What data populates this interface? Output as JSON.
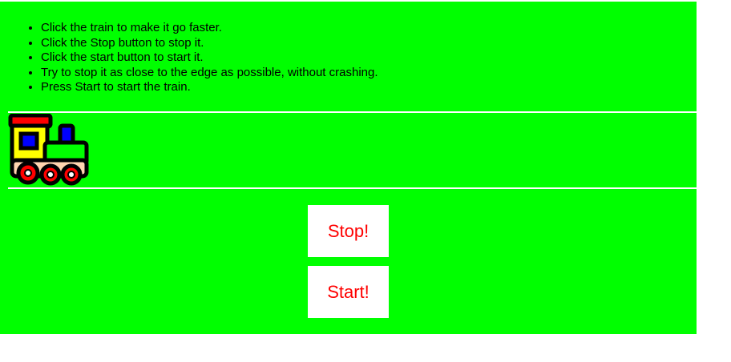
{
  "instructions": [
    "Click the train to make it go faster.",
    "Click the Stop button to stop it.",
    "Click the start button to start it.",
    "Try to stop it as close to the edge as possible, without crashing.",
    "Press Start to start the train."
  ],
  "buttons": {
    "stop_label": "Stop!",
    "start_label": "Start!"
  },
  "colors": {
    "background": "#00ff00",
    "button_text": "#ff0000",
    "button_bg": "#ffffff"
  },
  "train": {
    "icon": "train-icon"
  }
}
